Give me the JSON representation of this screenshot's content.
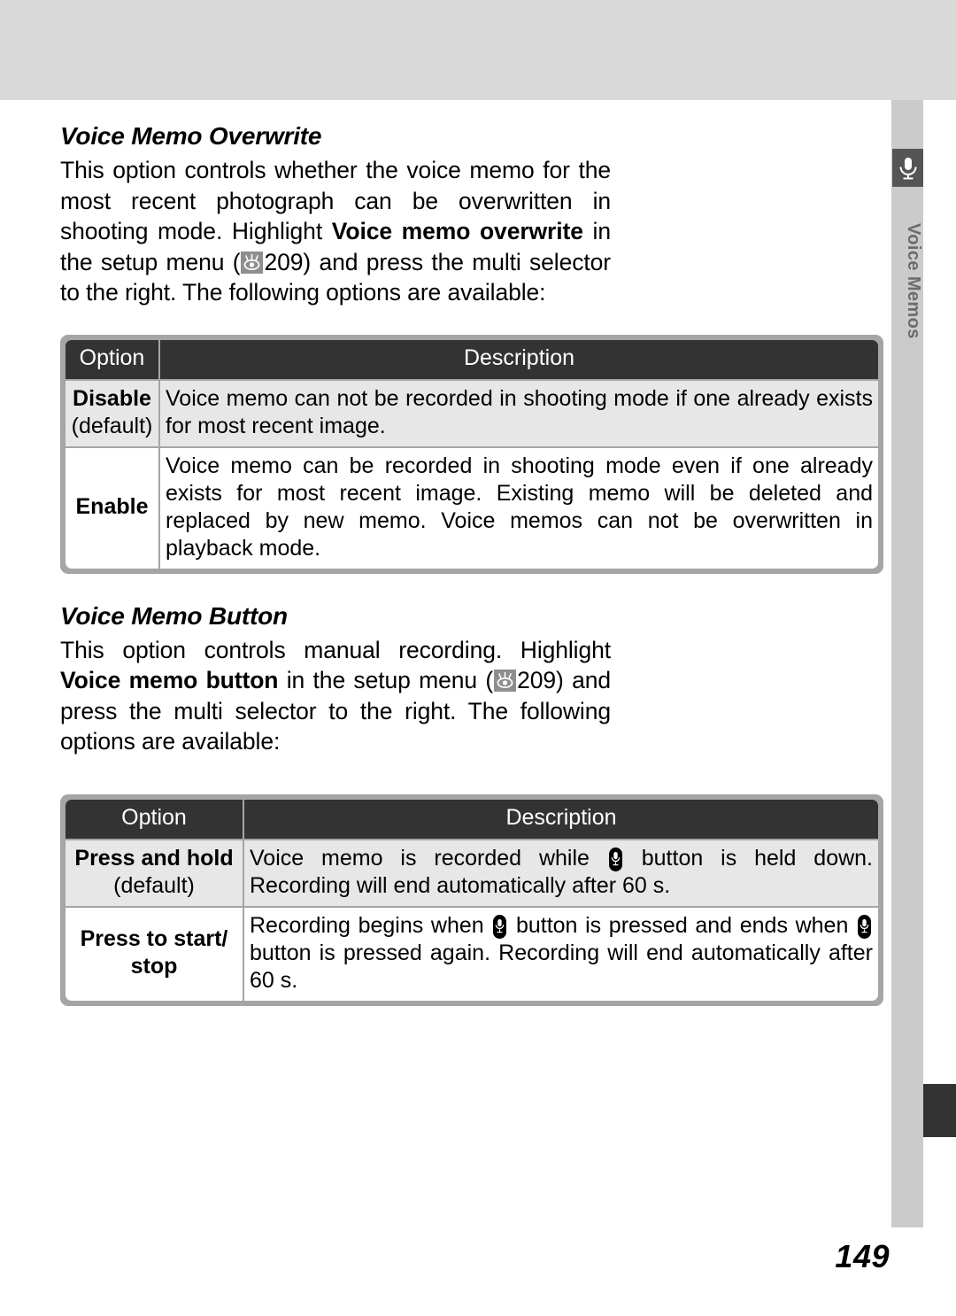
{
  "page": {
    "number": "149",
    "side_tab": {
      "label": "Voice Memos",
      "icon": "microphone-icon"
    }
  },
  "sections": [
    {
      "title": "Voice Memo Overwrite",
      "paragraph_parts": {
        "p1": "This option controls whether the voice memo for the most recent photograph can be overwritten in shooting mode.  Highlight ",
        "bold1": "Voice memo overwrite",
        "p2": " in the setup menu (",
        "icon": "setup-menu-icon",
        "page_ref": "209",
        "p3": ") and press the multi selector to the right.  The following options are available:"
      },
      "table": {
        "headers": [
          "Option",
          "Description"
        ],
        "rows": [
          {
            "option": "Disable",
            "option_note": "(default)",
            "description": "Voice memo can not be recorded in shooting mode if one already exists for most recent image."
          },
          {
            "option": "Enable",
            "option_note": "",
            "description": "Voice memo can be recorded in shooting mode even if one already exists for most recent image.  Existing memo will be deleted and replaced by new memo.  Voice memos can not be overwritten in playback mode."
          }
        ]
      }
    },
    {
      "title": "Voice Memo Button",
      "paragraph_parts": {
        "p1": "This option controls manual recording.  Highlight ",
        "bold1": "Voice memo button",
        "p2": " in the setup menu (",
        "icon": "setup-menu-icon",
        "page_ref": "209",
        "p3": ") and press the multi selector to the right.  The following options are available:"
      },
      "table": {
        "headers": [
          "Option",
          "Description"
        ],
        "rows": [
          {
            "option": "Press and hold",
            "option_note": "(default)",
            "description_before": "Voice memo is recorded while ",
            "description_after": " button is held down.  Recording will end automatically after 60 s."
          },
          {
            "option": "Press to start/ stop",
            "option_note": "",
            "description_before": "Recording begins when ",
            "description_mid": " button is pressed and ends when ",
            "description_after": " button is pressed again.  Recording will end automatically after 60 s."
          }
        ]
      }
    }
  ],
  "colors": {
    "band": "#d9d9d9",
    "rail": "#cbcbcb",
    "header_cell": "#333333",
    "shade_row": "#e7e7e7",
    "table_border": "#a5a5a5",
    "tab_icon_bg": "#555555",
    "tab_label": "#6b6b6b"
  }
}
